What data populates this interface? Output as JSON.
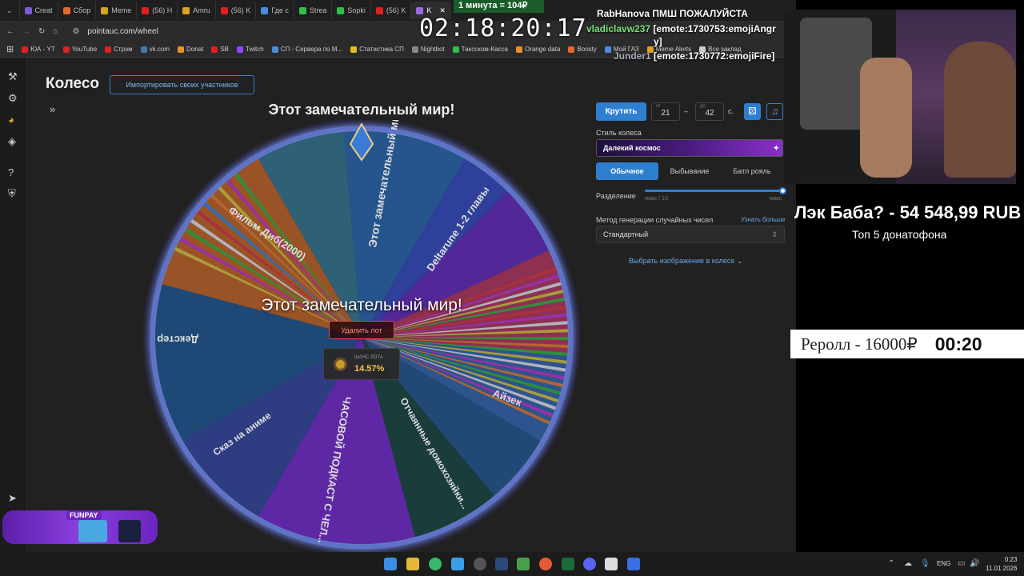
{
  "browser": {
    "tabs": [
      "Creat",
      "Сбор",
      "Meme",
      "(56) H",
      "Amru",
      "(56) K",
      "Где с",
      "Strea",
      "Sopki",
      "(56) K",
      "K"
    ],
    "url": "pointauc.com/wheel",
    "bookmarks": [
      "ЮА - YT",
      "YouTube",
      "Стрэм",
      "vk.com",
      "Donat",
      "SB",
      "Twitch",
      "СП - Сервера по М...",
      "Статистика СП",
      "Nightbot",
      "Таксском-Касса",
      "Orange data",
      "Boosty",
      "Мой ГАЗ",
      "Meme Alerts",
      "Все заклад"
    ]
  },
  "app": {
    "title": "Колесо",
    "import_button": "Импортировать своих участников",
    "wheel_title": "Этот замечательный мир!",
    "center_title": "Этот замечательный мир!",
    "delete_button": "Удалить лот",
    "chance_label": "ШАНС ЛОТА",
    "chance_value": "14.57%",
    "spin_button": "Крутить",
    "from_label": "от",
    "from_value": "21",
    "to_label": "до",
    "to_value": "42",
    "seconds_unit": "с.",
    "style_label": "Стиль колеса",
    "style_value": "Далекий космос",
    "modes": [
      "Обычное",
      "Выбывание",
      "Батл рояль"
    ],
    "split_label": "Разделение",
    "split_max_left": "макс / 10",
    "split_max_right": "макс",
    "rng_label": "Метод генерации случайных чисел",
    "rng_link": "Узнать больше",
    "rng_value": "Стандартный",
    "image_link": "Выбрать изображение в колесе"
  },
  "wheel_labels": [
    "Этот замечательный ми...",
    "Deltarune 1-2 главы",
    "Фильм Диб(2000)",
    "Декстер",
    "Айзек",
    "Отчаянные домохозяйки...",
    "ЧАСОВОЙ ПОДКАСТ С ЧЕЛ...",
    "Сказ на аниме"
  ],
  "overlay": {
    "timer": "02:18:20:17",
    "top_tab_text": "1 минута = 104₽",
    "chat": [
      {
        "user": "RabHanova",
        "msg": "ПМШ ПОЖАЛУЙСТА"
      },
      {
        "user": "vladiclavw237",
        "msg": "[emote:1730753:emojiAngr"
      },
      {
        "user": "",
        "msg": "y]"
      },
      {
        "user": "Junder1",
        "msg": "[emote:1730772:emojiFire]"
      }
    ],
    "donate_text": "Лэк Баба? - 54 548,99 RUB",
    "donate_sub": "Топ  5 донатофона",
    "reroll_text": "Реролл - 16000₽",
    "reroll_countdown": "00:20",
    "promo_text": "FUNPAY"
  },
  "taskbar": {
    "lang": "ENG",
    "time": "0:23",
    "date": "11.01.2026"
  }
}
